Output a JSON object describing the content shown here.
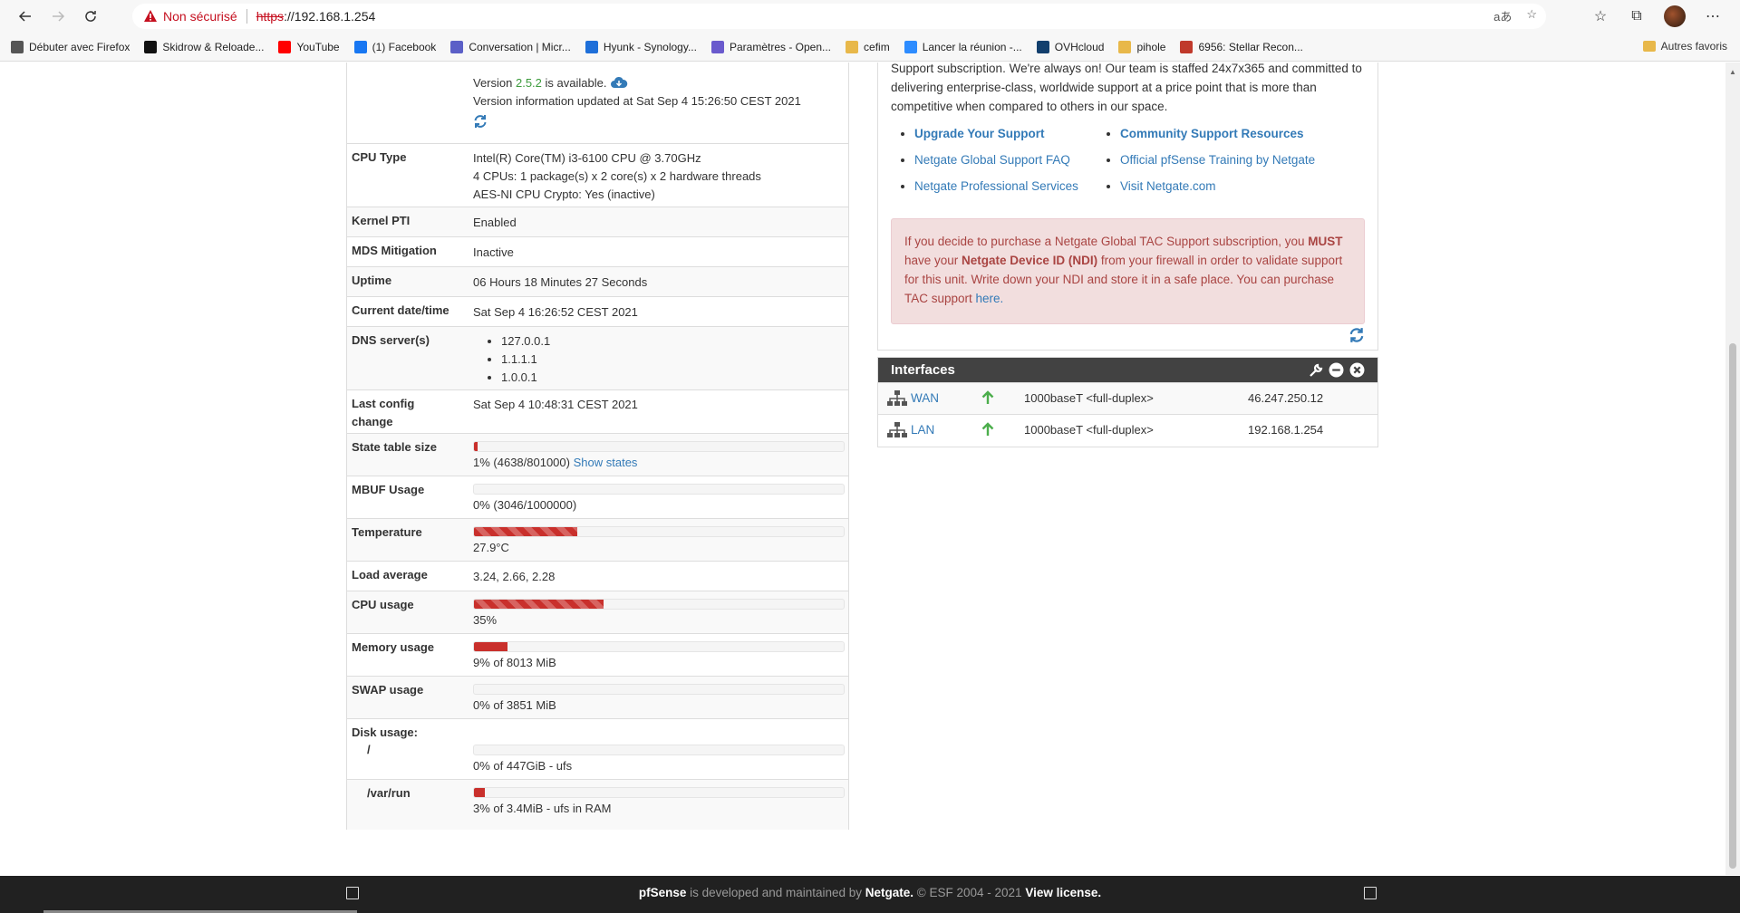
{
  "browser": {
    "security_label": "Non sécurisé",
    "url_scheme": "https",
    "url_rest": "://192.168.1.254",
    "translate_glyph": "aあ",
    "bookmarks": [
      {
        "label": "Débuter avec Firefox",
        "color": "#555555"
      },
      {
        "label": "Skidrow & Reloade...",
        "color": "#111111"
      },
      {
        "label": "YouTube",
        "color": "#ff0000"
      },
      {
        "label": "(1) Facebook",
        "color": "#1877f2"
      },
      {
        "label": "Conversation | Micr...",
        "color": "#5b5fc7"
      },
      {
        "label": "Hyunk - Synology...",
        "color": "#1e6fd9"
      },
      {
        "label": "Paramètres - Open...",
        "color": "#6a5acd"
      },
      {
        "label": "cefim",
        "color": "#e8b84a"
      },
      {
        "label": "Lancer la réunion -...",
        "color": "#2d8cff"
      },
      {
        "label": "OVHcloud",
        "color": "#123f6d"
      },
      {
        "label": "pihole",
        "color": "#e8b84a"
      },
      {
        "label": "6956: Stellar Recon...",
        "color": "#c0392b"
      }
    ],
    "other_bookmarks": "Autres favoris"
  },
  "sysinfo": {
    "version_prefix": "Version ",
    "version_number": "2.5.2",
    "version_suffix": " is available.",
    "version_updated": "Version information updated at Sat Sep 4 15:26:50 CEST 2021",
    "cpu_type_label": "CPU Type",
    "cpu_type_lines": [
      "Intel(R) Core(TM) i3-6100 CPU @ 3.70GHz",
      "4 CPUs: 1 package(s) x 2 core(s) x 2 hardware threads",
      "AES-NI CPU Crypto: Yes (inactive)"
    ],
    "kernel_pti_label": "Kernel PTI",
    "kernel_pti": "Enabled",
    "mds_label": "MDS Mitigation",
    "mds": "Inactive",
    "uptime_label": "Uptime",
    "uptime": "06 Hours 18 Minutes 27 Seconds",
    "datetime_label": "Current date/time",
    "datetime": "Sat Sep 4 16:26:52 CEST 2021",
    "dns_label": "DNS server(s)",
    "dns": [
      "127.0.0.1",
      "1.1.1.1",
      "1.0.0.1"
    ],
    "last_config_label_1": "Last config",
    "last_config_label_2": "change",
    "last_config": "Sat Sep 4 10:48:31 CEST 2021",
    "state_table_label": "State table size",
    "state_table_text": "1% (4638/801000)",
    "state_table_link": "Show states",
    "state_table_pct": 1,
    "mbuf_label": "MBUF Usage",
    "mbuf_text": "0% (3046/1000000)",
    "mbuf_pct": 0,
    "temp_label": "Temperature",
    "temp_text": "27.9°C",
    "temp_pct": 27.9,
    "load_label": "Load average",
    "load": "3.24, 2.66, 2.28",
    "cpu_usage_label": "CPU usage",
    "cpu_usage_text": "35%",
    "cpu_usage_pct": 35,
    "memory_label": "Memory usage",
    "memory_text": "9% of 8013 MiB",
    "memory_pct": 9,
    "swap_label": "SWAP usage",
    "swap_text": "0% of 3851 MiB",
    "swap_pct": 0,
    "disk_label": "Disk usage:",
    "disk_root_label": "/",
    "disk_root_text": "0% of 447GiB - ufs",
    "disk_root_pct": 0,
    "disk_varrun_label": "/var/run",
    "disk_varrun_text": "3% of 3.4MiB - ufs in RAM",
    "disk_varrun_pct": 3
  },
  "support": {
    "intro": "Support subscription. We're always on! Our team is staffed 24x7x365 and committed to delivering enterprise-class, worldwide support at a price point that is more than competitive when compared to others in our space.",
    "links_left": [
      "Upgrade Your Support",
      "Netgate Global Support FAQ",
      "Netgate Professional Services"
    ],
    "links_right": [
      "Community Support Resources",
      "Official pfSense Training by Netgate",
      "Visit Netgate.com"
    ],
    "alert_1": "If you decide to purchase a Netgate Global TAC Support subscription, you ",
    "alert_must": "MUST",
    "alert_2": " have your ",
    "alert_ndi": "Netgate Device ID (NDI)",
    "alert_3": " from your firewall in order to validate support for this unit. Write down your NDI and store it in a safe place. You can purchase TAC support ",
    "alert_here": "here."
  },
  "interfaces": {
    "title": "Interfaces",
    "rows": [
      {
        "name": "WAN",
        "media": "1000baseT <full-duplex>",
        "ip": "46.247.250.12"
      },
      {
        "name": "LAN",
        "media": "1000baseT <full-duplex>",
        "ip": "192.168.1.254"
      }
    ]
  },
  "footer": {
    "brand": "pfSense",
    "text1": " is developed and maintained by ",
    "netgate": "Netgate.",
    "text2": " © ESF 2004 - 2021 ",
    "license": "View license."
  }
}
